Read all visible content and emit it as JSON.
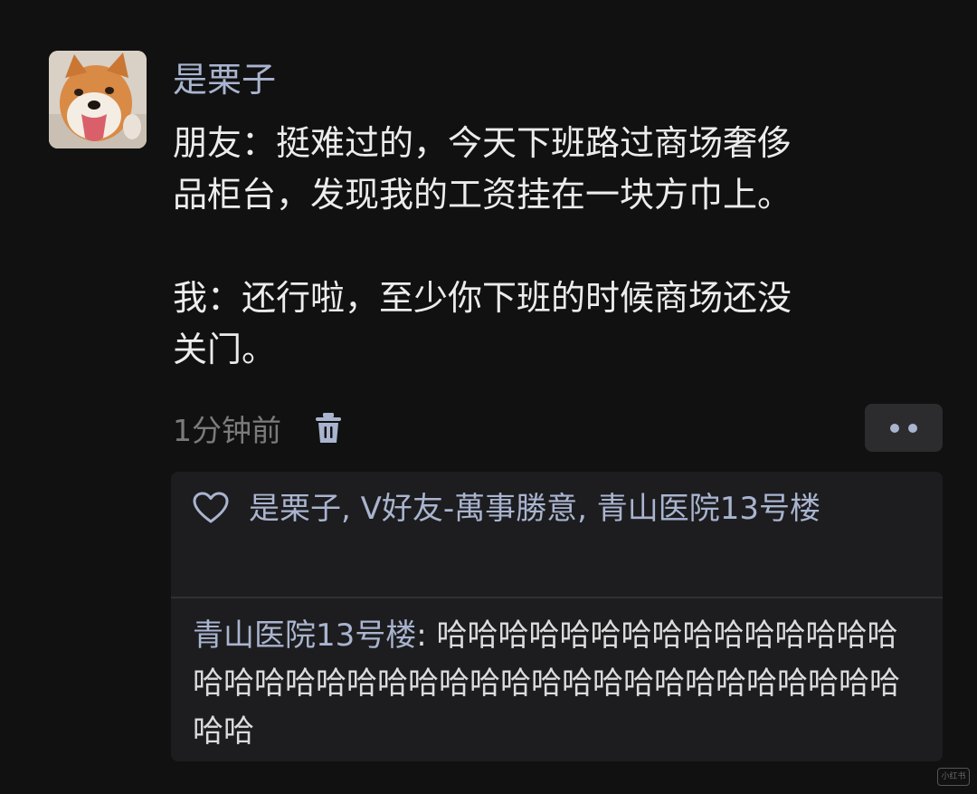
{
  "post": {
    "author": "是栗子",
    "avatar_icon": "shiba-dog-avatar",
    "paragraphs": [
      "朋友：挺难过的，今天下班路过商场奢侈",
      "品柜台，发现我的工资挂在一块方巾上。",
      "我：还行啦，至少你下班的时候商场还没",
      "关门。"
    ],
    "timestamp": "1分钟前",
    "delete_icon": "trash-icon",
    "more_icon": "more-dots-icon"
  },
  "likes": {
    "icon": "heart-icon",
    "text": "是栗子, V好友-萬事勝意, 青山医院13号楼"
  },
  "comment": {
    "author": "青山医院13号楼",
    "separator": ": ",
    "text": "哈哈哈哈哈哈哈哈哈哈哈哈哈哈哈哈哈哈哈哈哈哈哈哈哈哈哈哈哈哈哈哈哈哈哈哈哈哈哈哈"
  },
  "watermark": "小红书",
  "colors": {
    "background": "#111111",
    "link": "#a9b4cf",
    "panel": "#1d1d1f",
    "muted": "#7b7b7b"
  }
}
